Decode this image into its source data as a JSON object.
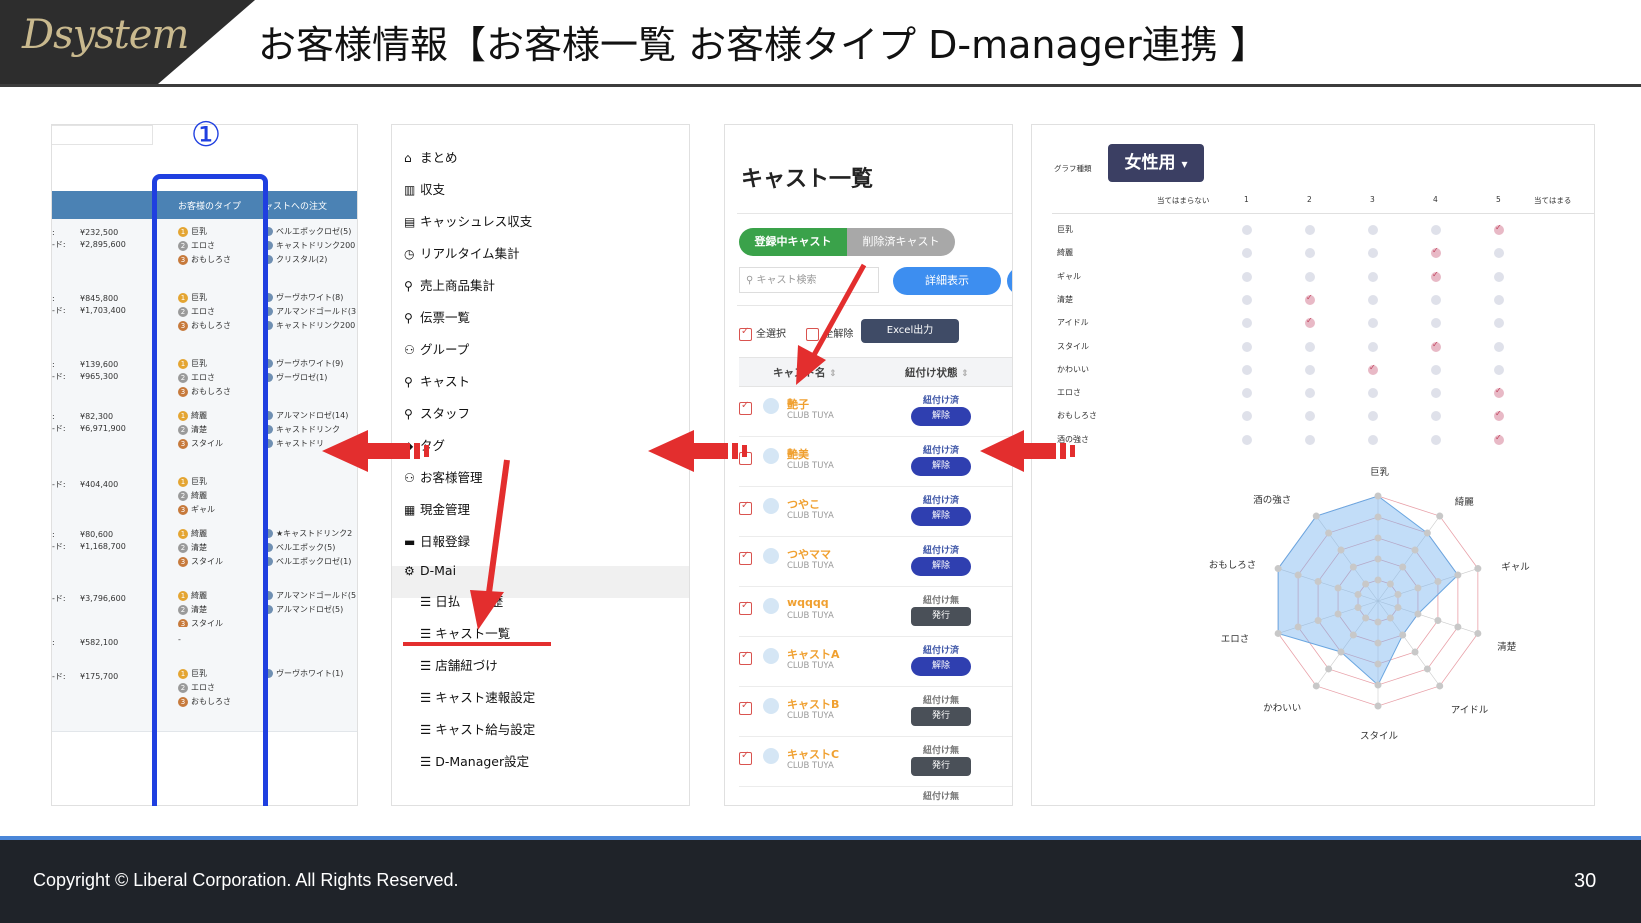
{
  "header": {
    "logo_text": "Dsystem",
    "title": "お客様情報【お客様一覧 お客様タイプ D-manager連携 】"
  },
  "footer": {
    "copyright": "Copyright ©  Liberal Corporation. All Rights Reserved.",
    "page_number": "30"
  },
  "marker": "①",
  "panel1": {
    "headers": [
      "お客様のタイプ",
      "ャストへの注文"
    ],
    "rows": [
      {
        "pref": [
          ":",
          "-ド:"
        ],
        "amounts": [
          "¥232,500",
          "¥2,895,600"
        ],
        "types": [
          "巨乳",
          "エロさ",
          "おもしろさ"
        ],
        "orders": [
          "ベルエポックロゼ(5)",
          "キャストドリンク200",
          "クリスタル(2)"
        ]
      },
      {
        "pref": [
          ":",
          "-ド:"
        ],
        "amounts": [
          "¥845,800",
          "¥1,703,400"
        ],
        "types": [
          "巨乳",
          "エロさ",
          "おもしろさ"
        ],
        "orders": [
          "ヴーヴホワイト(8)",
          "アルマンドゴールド(3",
          "キャストドリンク200"
        ]
      },
      {
        "pref": [
          ":",
          "-ド:"
        ],
        "amounts": [
          "¥139,600",
          "¥965,300"
        ],
        "types": [
          "巨乳",
          "エロさ",
          "おもしろさ"
        ],
        "orders": [
          "ヴーヴホワイト(9)",
          "ヴーヴロゼ(1)"
        ]
      },
      {
        "pref": [
          ":",
          "-ド:"
        ],
        "amounts": [
          "¥82,300",
          "¥6,971,900"
        ],
        "types": [
          "綺麗",
          "清楚",
          "スタイル"
        ],
        "orders": [
          "アルマンドロゼ(14)",
          "キャストドリンク",
          "キャストドリ"
        ]
      },
      {
        "pref": [
          "-ド:"
        ],
        "amounts": [
          "¥404,400"
        ],
        "types": [
          "巨乳",
          "綺麗",
          "ギャル"
        ],
        "orders": []
      },
      {
        "pref": [
          ":",
          "-ド:"
        ],
        "amounts": [
          "¥80,600",
          "¥1,168,700"
        ],
        "types": [
          "綺麗",
          "清楚",
          "スタイル"
        ],
        "orders": [
          "★キャストドリンク2",
          "ベルエポック(5)",
          "ベルエポックロゼ(1)"
        ]
      },
      {
        "pref": [
          "-ド:"
        ],
        "amounts": [
          "¥3,796,600"
        ],
        "types": [
          "綺麗",
          "清楚",
          "スタイル"
        ],
        "orders": [
          "アルマンドゴールド(5",
          "アルマンドロゼ(5)"
        ]
      },
      {
        "pref": [
          ":"
        ],
        "amounts": [
          "¥582,100"
        ],
        "types": [
          "-"
        ],
        "orders": []
      },
      {
        "pref": [
          "-ド:"
        ],
        "amounts": [
          "¥175,700"
        ],
        "types": [
          "巨乳",
          "エロさ",
          "おもしろさ"
        ],
        "orders": [
          "ヴーヴホワイト(1)"
        ]
      }
    ]
  },
  "panel2": {
    "menu": [
      {
        "icon": "home-icon",
        "glyph": "⌂",
        "label": "まとめ"
      },
      {
        "icon": "bar-chart-icon",
        "glyph": "▥",
        "label": "収支"
      },
      {
        "icon": "document-icon",
        "glyph": "▤",
        "label": "キャッシュレス収支"
      },
      {
        "icon": "clock-icon",
        "glyph": "◷",
        "label": "リアルタイム集計"
      },
      {
        "icon": "bottle-icon",
        "glyph": "⚲",
        "label": "売上商品集計"
      },
      {
        "icon": "search-icon",
        "glyph": "⚲",
        "label": "伝票一覧"
      },
      {
        "icon": "users-icon",
        "glyph": "⚇",
        "label": "グループ"
      },
      {
        "icon": "person-icon",
        "glyph": "⚲",
        "label": "キャスト"
      },
      {
        "icon": "person-icon",
        "glyph": "⚲",
        "label": "スタッフ"
      },
      {
        "icon": "tag-icon",
        "glyph": "◆",
        "label": "タグ"
      },
      {
        "icon": "users-icon",
        "glyph": "⚇",
        "label": "お客様管理"
      },
      {
        "icon": "calculator-icon",
        "glyph": "▦",
        "label": "現金管理"
      },
      {
        "icon": "calendar-icon",
        "glyph": "▬",
        "label": "日報登録"
      },
      {
        "icon": "gear-icon",
        "glyph": "⚙",
        "label": "D-Mai"
      }
    ],
    "submenu": [
      "日払",
      "履歴",
      "キャスト一覧",
      "店舗紐づけ",
      "キャスト速報設定",
      "キャスト給与設定",
      "D-Manager設定"
    ],
    "list_glyph": "☰"
  },
  "panel3": {
    "title": "キャスト一覧",
    "tab_active": "登録中キャスト",
    "tab_inactive": "削除済キャスト",
    "search_placeholder": "キャスト検索",
    "search_glyph": "⚲",
    "detail_button": "詳細表示",
    "select_all": "全選択",
    "deselect": "全解除",
    "excel_button": "Excel出力",
    "col_cast": "キャスト名",
    "col_status": "紐付け状態",
    "sort_glyph": "⇕",
    "rows": [
      {
        "name": "艶子",
        "club": "CLUB TUYA",
        "status": "紐付け済",
        "action": "解除"
      },
      {
        "name": "艶美",
        "club": "CLUB TUYA",
        "status": "紐付け済",
        "action": "解除"
      },
      {
        "name": "つやこ",
        "club": "CLUB TUYA",
        "status": "紐付け済",
        "action": "解除"
      },
      {
        "name": "つやママ",
        "club": "CLUB TUYA",
        "status": "紐付け済",
        "action": "解除"
      },
      {
        "name": "wqqqq",
        "club": "CLUB TUYA",
        "status": "紐付け無",
        "action": "発行"
      },
      {
        "name": "キャストA",
        "club": "CLUB TUYA",
        "status": "紐付け済",
        "action": "解除"
      },
      {
        "name": "キャストB",
        "club": "CLUB TUYA",
        "status": "紐付け無",
        "action": "発行"
      },
      {
        "name": "キャストC",
        "club": "CLUB TUYA",
        "status": "紐付け無",
        "action": "発行"
      }
    ],
    "partial_status": "紐付け無"
  },
  "panel4": {
    "graph_label": "グラフ種類",
    "dropdown": "女性用",
    "dropdown_glyph": "▾",
    "scale_left": "当てはまらない",
    "scale_right": "当てはまる",
    "scale": [
      "1",
      "2",
      "3",
      "4",
      "5"
    ],
    "attributes": [
      "巨乳",
      "綺麗",
      "ギャル",
      "清楚",
      "アイドル",
      "スタイル",
      "かわいい",
      "エロさ",
      "おもしろさ",
      "酒の強さ"
    ],
    "selected": [
      5,
      4,
      4,
      2,
      2,
      4,
      3,
      5,
      5,
      5
    ],
    "radar_labels": [
      "巨乳",
      "綺麗",
      "ギャル",
      "清楚",
      "アイドル",
      "スタイル",
      "かわいい",
      "エロさ",
      "おもしろさ",
      "酒の強さ"
    ]
  }
}
